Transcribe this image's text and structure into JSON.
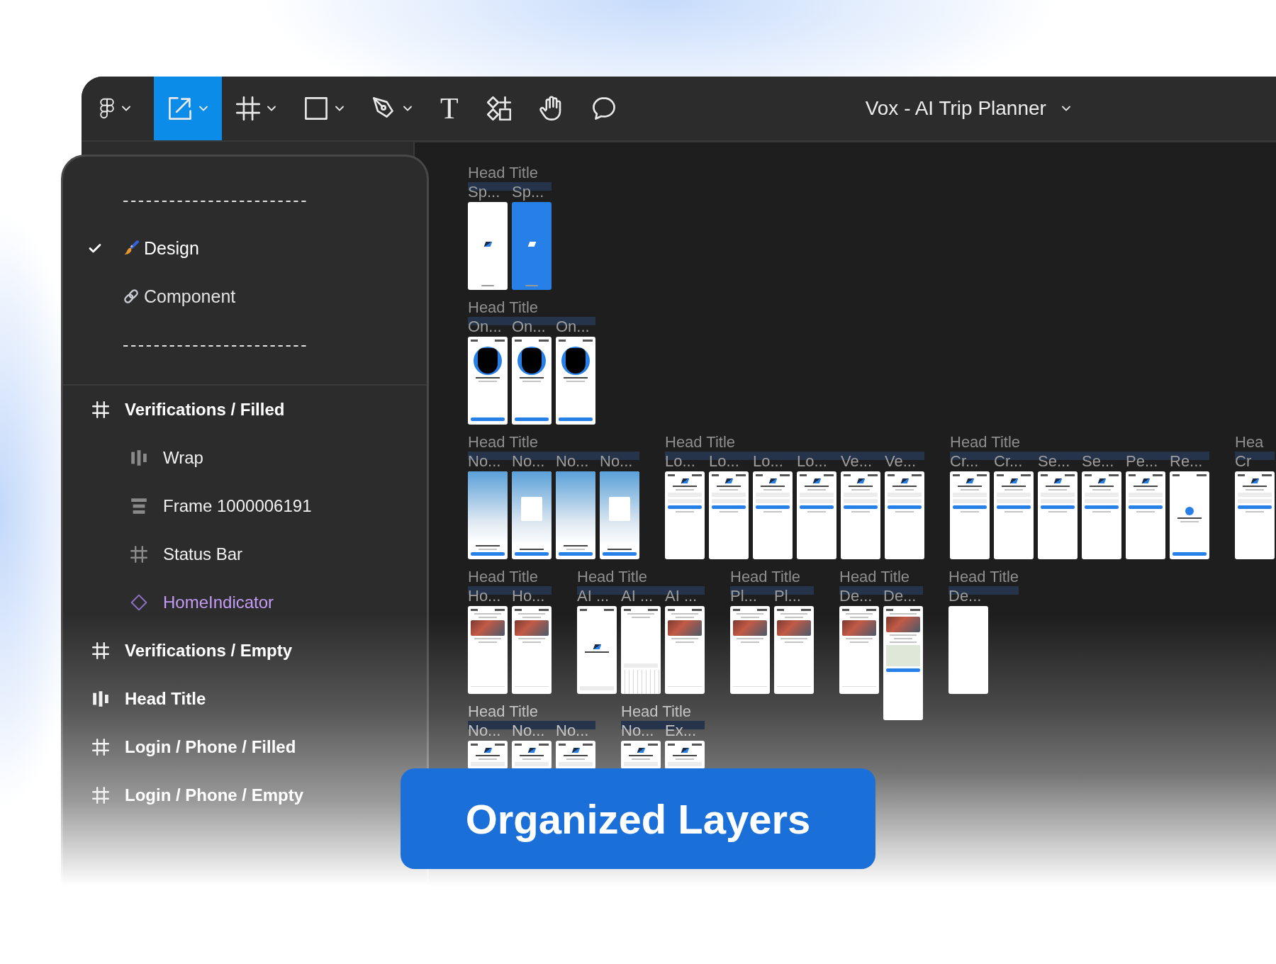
{
  "toolbar": {
    "tools": [
      {
        "kind": "logo",
        "selected": false,
        "dropdown": true
      },
      {
        "kind": "scale",
        "selected": true,
        "dropdown": true
      },
      {
        "kind": "frame",
        "selected": false,
        "dropdown": true
      },
      {
        "kind": "shape",
        "selected": false,
        "dropdown": true
      },
      {
        "kind": "pen",
        "selected": false,
        "dropdown": true
      },
      {
        "kind": "text",
        "glyph": "T",
        "selected": false,
        "dropdown": false
      },
      {
        "kind": "components",
        "selected": false,
        "dropdown": false
      },
      {
        "kind": "hand",
        "selected": false,
        "dropdown": false
      },
      {
        "kind": "comment",
        "selected": false,
        "dropdown": false
      }
    ],
    "file_title": "Vox - AI Trip Planner"
  },
  "page_menu": {
    "pages": [
      {
        "kind": "separator",
        "label": "------------------------",
        "selected": false
      },
      {
        "kind": "page",
        "label": "Design",
        "selected": true
      },
      {
        "kind": "page",
        "label": "Component",
        "selected": false
      },
      {
        "kind": "separator",
        "label": "------------------------",
        "selected": false
      }
    ],
    "layers": [
      {
        "kind": "frame",
        "label": "Verifications / Filled",
        "children": [
          {
            "kind": "autolayout-row",
            "label": "Wrap"
          },
          {
            "kind": "autolayout-column",
            "label": "Frame 1000006191"
          },
          {
            "kind": "frame",
            "label": "Status Bar"
          },
          {
            "kind": "instance",
            "label": "HomeIndicator"
          }
        ]
      },
      {
        "kind": "frame",
        "label": "Verifications / Empty"
      },
      {
        "kind": "autolayout-row",
        "label": "Head Title"
      },
      {
        "kind": "frame",
        "label": "Login / Phone / Filled"
      },
      {
        "kind": "frame",
        "label": "Login / Phone / Empty"
      }
    ]
  },
  "canvas": {
    "rows": [
      {
        "groups": [
          {
            "title": "Head Title",
            "frames": [
              {
                "name": "Sp...",
                "kind": "splash"
              },
              {
                "name": "Sp...",
                "kind": "splash-blue"
              }
            ]
          }
        ]
      },
      {
        "groups": [
          {
            "title": "Head Title",
            "frames": [
              {
                "name": "On...",
                "kind": "onboarding"
              },
              {
                "name": "On...",
                "kind": "onboarding"
              },
              {
                "name": "On...",
                "kind": "onboarding"
              }
            ]
          }
        ]
      },
      {
        "groups": [
          {
            "title": "Head Title",
            "frames": [
              {
                "name": "No...",
                "kind": "photo"
              },
              {
                "name": "No...",
                "kind": "photo-dialog"
              },
              {
                "name": "No...",
                "kind": "photo"
              },
              {
                "name": "No...",
                "kind": "photo-dialog"
              }
            ]
          },
          {
            "title": "Head Title",
            "frames": [
              {
                "name": "Lo...",
                "kind": "form"
              },
              {
                "name": "Lo...",
                "kind": "form"
              },
              {
                "name": "Lo...",
                "kind": "form"
              },
              {
                "name": "Lo...",
                "kind": "form"
              },
              {
                "name": "Ve...",
                "kind": "form"
              },
              {
                "name": "Ve...",
                "kind": "form"
              }
            ]
          },
          {
            "title": "Head Title",
            "frames": [
              {
                "name": "Cr...",
                "kind": "form"
              },
              {
                "name": "Cr...",
                "kind": "form"
              },
              {
                "name": "Se...",
                "kind": "form"
              },
              {
                "name": "Se...",
                "kind": "form"
              },
              {
                "name": "Pe...",
                "kind": "form"
              },
              {
                "name": "Re...",
                "kind": "success"
              }
            ]
          },
          {
            "title": "Hea",
            "frames": [
              {
                "name": "Cr",
                "kind": "form"
              }
            ]
          }
        ]
      },
      {
        "groups": [
          {
            "title": "Head Title",
            "frames": [
              {
                "name": "Ho...",
                "kind": "home"
              },
              {
                "name": "Ho...",
                "kind": "home"
              }
            ]
          },
          {
            "title": "Head Title",
            "frames": [
              {
                "name": "AI ...",
                "kind": "chat"
              },
              {
                "name": "AI ...",
                "kind": "keyboard"
              },
              {
                "name": "AI ...",
                "kind": "home"
              }
            ]
          },
          {
            "title": "Head Title",
            "frames": [
              {
                "name": "Pl...",
                "kind": "home"
              },
              {
                "name": "Pl...",
                "kind": "home"
              }
            ]
          },
          {
            "title": "Head Title",
            "frames": [
              {
                "name": "De...",
                "kind": "home"
              },
              {
                "name": "De...",
                "kind": "map"
              }
            ]
          },
          {
            "title": "Head Title",
            "frames": [
              {
                "name": "De...",
                "kind": "blank"
              }
            ]
          }
        ]
      },
      {
        "groups": [
          {
            "title": "Head Title",
            "frames": [
              {
                "name": "No...",
                "kind": "form"
              },
              {
                "name": "No...",
                "kind": "form"
              },
              {
                "name": "No...",
                "kind": "form"
              }
            ]
          },
          {
            "title": "Head Title",
            "frames": [
              {
                "name": "No...",
                "kind": "form"
              },
              {
                "name": "Ex...",
                "kind": "form"
              }
            ]
          }
        ]
      }
    ]
  },
  "banner": {
    "label": "Organized Layers"
  }
}
